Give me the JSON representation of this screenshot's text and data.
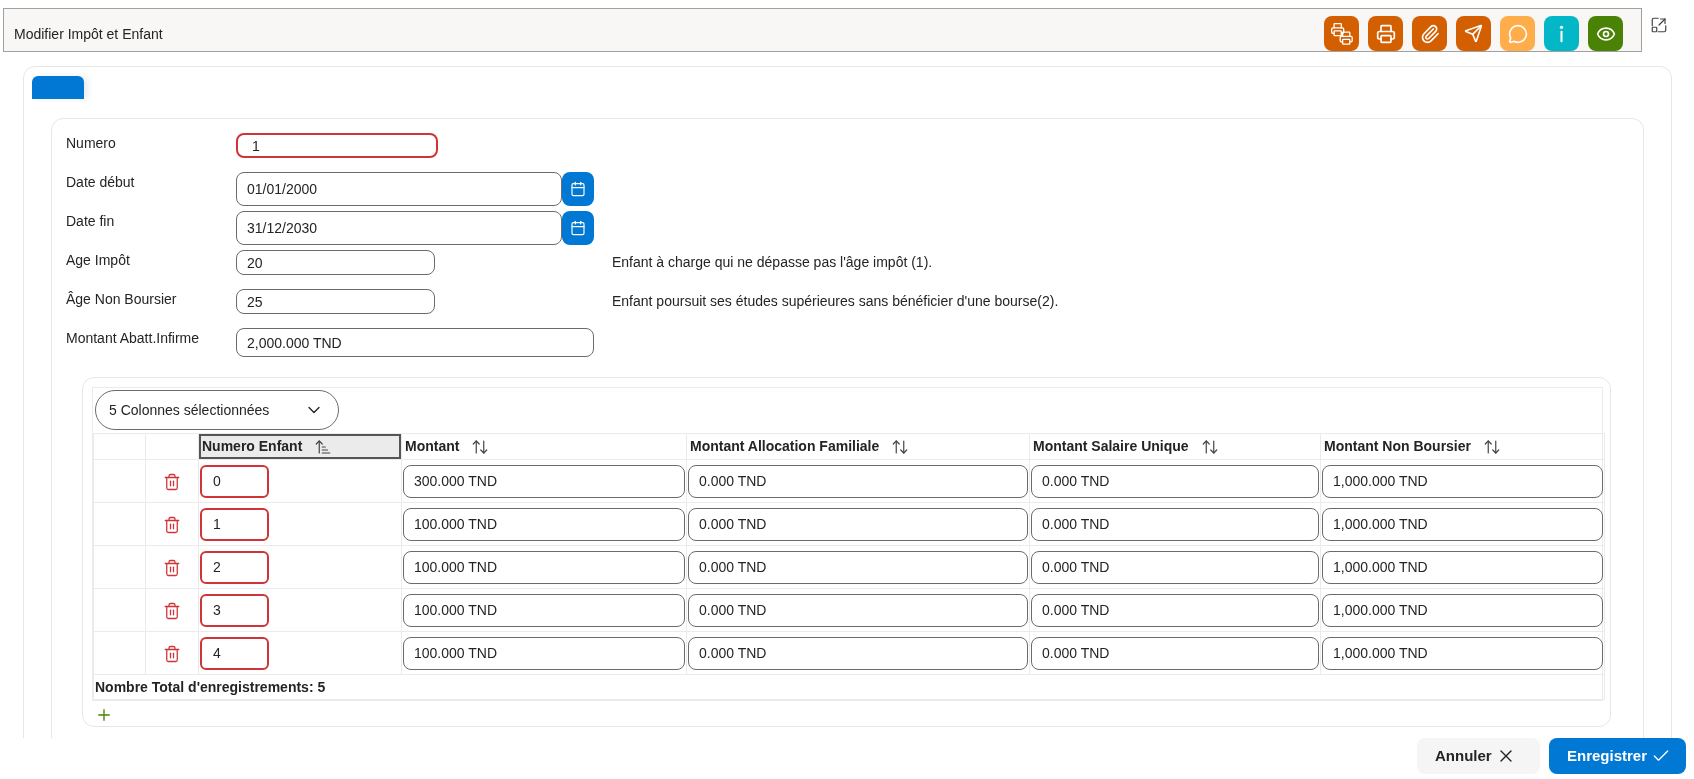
{
  "window": {
    "title": "Modifier Impôt et Enfant"
  },
  "toolbar": [
    {
      "kind": "print-all",
      "color": "#d35f00"
    },
    {
      "kind": "print",
      "color": "#d35f00"
    },
    {
      "kind": "attach",
      "color": "#d35f00"
    },
    {
      "kind": "send",
      "color": "#d35f00"
    },
    {
      "kind": "comment",
      "color": "#ffac4b"
    },
    {
      "kind": "info",
      "color": "#03b7c6"
    },
    {
      "kind": "view",
      "color": "#498205"
    }
  ],
  "tabs": [
    {
      "selected": true
    }
  ],
  "form": {
    "fields": [
      {
        "kind": "text",
        "label": "Numero",
        "value": "1",
        "required": true
      },
      {
        "kind": "date",
        "label": "Date début",
        "value": "01/01/2000",
        "required": false
      },
      {
        "kind": "date",
        "label": "Date fin",
        "value": "31/12/2030",
        "required": false
      },
      {
        "kind": "number",
        "label": "Age Impôt",
        "value": "20",
        "required": false,
        "note": "Enfant à charge qui ne dépasse pas l'âge impôt (1)."
      },
      {
        "kind": "number",
        "label": "Âge Non Boursier",
        "value": "25",
        "required": false,
        "note": "Enfant poursuit ses études supérieures sans bénéficier d'une bourse(2)."
      },
      {
        "kind": "amount",
        "label": "Montant Abatt.Infirme",
        "value": "2,000.000 TND",
        "required": false
      }
    ]
  },
  "table": {
    "column_chooser": "5 Colonnes sélectionnées",
    "columns": [
      {
        "label": "Numero Enfant",
        "sorted": true,
        "selected": true,
        "required": true
      },
      {
        "label": "Montant",
        "sorted": false,
        "selected": false,
        "required": false
      },
      {
        "label": "Montant Allocation Familiale",
        "sorted": false,
        "selected": false,
        "required": false
      },
      {
        "label": "Montant Salaire Unique",
        "sorted": false,
        "selected": false,
        "required": false
      },
      {
        "label": "Montant Non Boursier",
        "sorted": false,
        "selected": false,
        "required": false
      }
    ],
    "rows": [
      {
        "cells": [
          "0",
          "300.000 TND",
          "0.000 TND",
          "0.000 TND",
          "1,000.000 TND"
        ]
      },
      {
        "cells": [
          "1",
          "100.000 TND",
          "0.000 TND",
          "0.000 TND",
          "1,000.000 TND"
        ]
      },
      {
        "cells": [
          "2",
          "100.000 TND",
          "0.000 TND",
          "0.000 TND",
          "1,000.000 TND"
        ]
      },
      {
        "cells": [
          "3",
          "100.000 TND",
          "0.000 TND",
          "0.000 TND",
          "1,000.000 TND"
        ]
      },
      {
        "cells": [
          "4",
          "100.000 TND",
          "0.000 TND",
          "0.000 TND",
          "1,000.000 TND"
        ]
      }
    ],
    "total": "Nombre Total d'enregistrements: 5"
  },
  "actions": [
    {
      "kind": "cancel",
      "label": "Annuler"
    },
    {
      "kind": "save",
      "label": "Enregistrer"
    }
  ]
}
